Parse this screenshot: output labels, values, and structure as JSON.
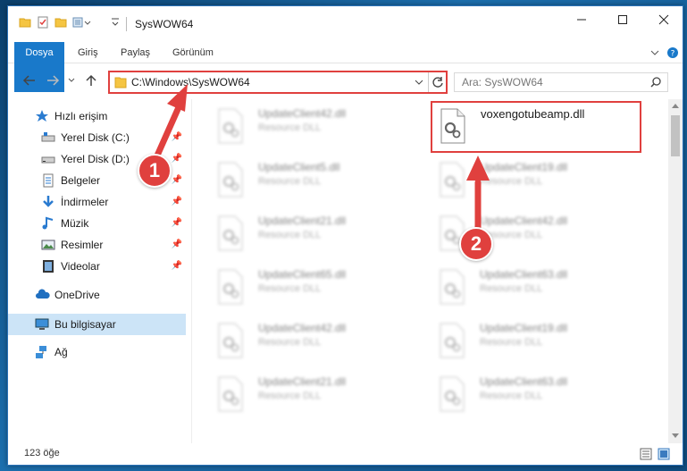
{
  "window": {
    "title": "SysWOW64",
    "min_icon": "minimize-icon",
    "max_icon": "maximize-icon",
    "close_icon": "close-icon"
  },
  "ribbon": {
    "tabs": [
      {
        "label": "Dosya"
      },
      {
        "label": "Giriş"
      },
      {
        "label": "Paylaş"
      },
      {
        "label": "Görünüm"
      }
    ],
    "expand_icon": "chevron-down-icon",
    "help_icon": "help-icon"
  },
  "address": {
    "path": "C:\\Windows\\SysWOW64",
    "search_placeholder": "Ara: SysWOW64"
  },
  "sidebar": {
    "items": [
      {
        "label": "Hızlı erişim",
        "icon": "star-icon"
      },
      {
        "label": "Yerel Disk (C:)",
        "icon": "drive-icon"
      },
      {
        "label": "Yerel Disk (D:)",
        "icon": "drive-icon"
      },
      {
        "label": "Belgeler",
        "icon": "documents-icon"
      },
      {
        "label": "İndirmeler",
        "icon": "download-icon"
      },
      {
        "label": "Müzik",
        "icon": "music-icon"
      },
      {
        "label": "Resimler",
        "icon": "pictures-icon"
      },
      {
        "label": "Videolar",
        "icon": "videos-icon"
      },
      {
        "label": "OneDrive",
        "icon": "cloud-icon"
      },
      {
        "label": "Bu bilgisayar",
        "icon": "computer-icon"
      },
      {
        "label": "Ağ",
        "icon": "network-icon"
      }
    ]
  },
  "files": {
    "left": [
      {
        "name": "UpdateClient42.dll",
        "type": "Resource DLL"
      },
      {
        "name": "UpdateClient5.dll",
        "type": "Resource DLL"
      },
      {
        "name": "UpdateClient21.dll",
        "type": "Resource DLL"
      },
      {
        "name": "UpdateClient65.dll",
        "type": "Resource DLL"
      },
      {
        "name": "UpdateClient42.dll",
        "type": "Resource DLL"
      },
      {
        "name": "UpdateClient21.dll",
        "type": "Resource DLL"
      }
    ],
    "right_highlight": {
      "name": "voxengotubeamp.dll",
      "type": ""
    },
    "right": [
      {
        "name": "UpdateClient19.dll",
        "type": "Resource DLL"
      },
      {
        "name": "UpdateClient42.dll",
        "type": "Resource DLL"
      },
      {
        "name": "UpdateClient63.dll",
        "type": "Resource DLL"
      },
      {
        "name": "UpdateClient19.dll",
        "type": "Resource DLL"
      },
      {
        "name": "UpdateClient63.dll",
        "type": "Resource DLL"
      }
    ]
  },
  "status": {
    "count": "123 öğe"
  },
  "annotations": {
    "step1": "1",
    "step2": "2",
    "color": "#e0403e"
  }
}
